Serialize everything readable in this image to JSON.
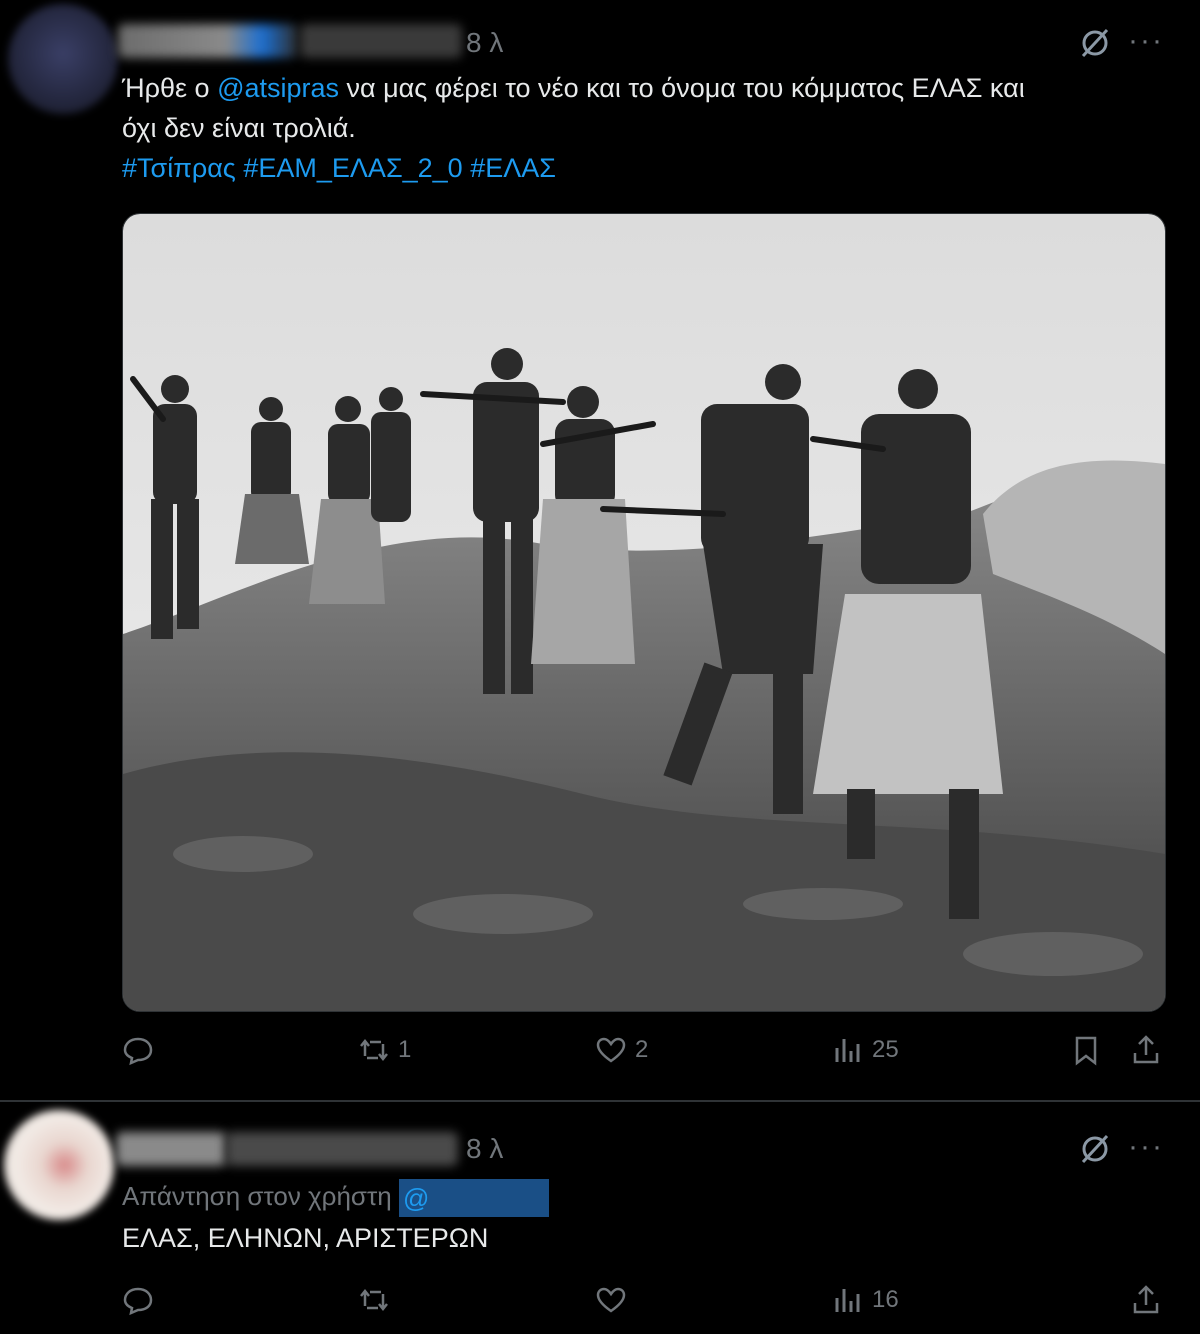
{
  "tweet1": {
    "time": "8 λ",
    "text_line1_pre": "Ήρθε ο ",
    "mention": "@atsipras",
    "text_line1_post": " να μας φέρει το νέο και το όνομα του κόμματος ΕΛΑΣ και",
    "text_line2": "όχι δεν είναι τρολιά.",
    "hashtags": [
      "#Τσίπρας",
      "#ΕΑΜ_ΕΛΑΣ_2_0",
      "#ΕΛΑΣ"
    ],
    "media": "black-and-white photo of partisans walking in a line with rifles on a rocky hillside",
    "stats": {
      "replies": "",
      "reposts": "1",
      "likes": "2",
      "views": "25"
    }
  },
  "tweet2": {
    "time": "8 λ",
    "reply_to_label": "Απάντηση στον χρήστη",
    "reply_to_handle": "@",
    "text": "ΕΛΑΣ, ΕΛΗΝΩΝ, ΑΡΙΣΤΕΡΩΝ",
    "stats": {
      "views": "16"
    }
  },
  "icons": [
    "grok-icon",
    "more-icon",
    "reply-icon",
    "repost-icon",
    "like-icon",
    "views-icon",
    "bookmark-icon",
    "share-icon"
  ],
  "colors": {
    "background": "#000000",
    "text": "#e7e9ea",
    "muted": "#71767b",
    "link": "#1d9bf0",
    "divider": "#2f3336"
  }
}
